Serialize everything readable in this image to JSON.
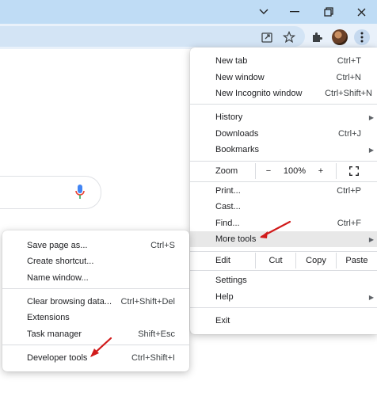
{
  "titlebar": {
    "minimize_glyph": "—",
    "restore_glyph": "❐",
    "close_glyph": "✕",
    "dropdown_glyph": "⌄"
  },
  "colors": {
    "titlebar": "#bfdcf5",
    "toolbar": "#e9f1fa",
    "highlight": "#e8e8e8",
    "annotation_arrow": "#d11b1b"
  },
  "main_menu": {
    "new_tab": {
      "label": "New tab",
      "shortcut": "Ctrl+T"
    },
    "new_window": {
      "label": "New window",
      "shortcut": "Ctrl+N"
    },
    "new_incognito": {
      "label": "New Incognito window",
      "shortcut": "Ctrl+Shift+N"
    },
    "history": {
      "label": "History"
    },
    "downloads": {
      "label": "Downloads",
      "shortcut": "Ctrl+J"
    },
    "bookmarks": {
      "label": "Bookmarks"
    },
    "zoom": {
      "label": "Zoom",
      "minus": "−",
      "value": "100%",
      "plus": "+",
      "fullscreen": "⛶"
    },
    "print": {
      "label": "Print...",
      "shortcut": "Ctrl+P"
    },
    "cast": {
      "label": "Cast..."
    },
    "find": {
      "label": "Find...",
      "shortcut": "Ctrl+F"
    },
    "more_tools": {
      "label": "More tools"
    },
    "edit": {
      "label": "Edit",
      "cut": "Cut",
      "copy": "Copy",
      "paste": "Paste"
    },
    "settings": {
      "label": "Settings"
    },
    "help": {
      "label": "Help"
    },
    "exit": {
      "label": "Exit"
    },
    "submenu_arrow": "▶"
  },
  "more_tools_menu": {
    "save_page": {
      "label": "Save page as...",
      "shortcut": "Ctrl+S"
    },
    "create_shortcut": {
      "label": "Create shortcut..."
    },
    "name_window": {
      "label": "Name window..."
    },
    "clear_data": {
      "label": "Clear browsing data...",
      "shortcut": "Ctrl+Shift+Del"
    },
    "extensions": {
      "label": "Extensions"
    },
    "task_manager": {
      "label": "Task manager",
      "shortcut": "Shift+Esc"
    },
    "developer_tools": {
      "label": "Developer tools",
      "shortcut": "Ctrl+Shift+I"
    }
  }
}
